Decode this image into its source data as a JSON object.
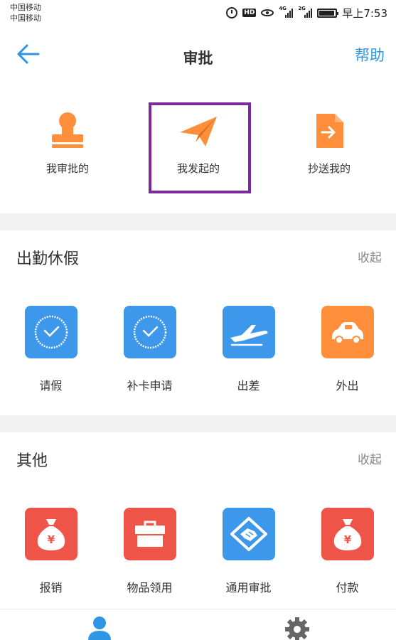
{
  "status_bar": {
    "carrier_1": "中国移动",
    "carrier_2": "中国移动",
    "hd_badge": "HD",
    "network_1": "4G",
    "network_2": "2G",
    "time": "早上7:53"
  },
  "header": {
    "title": "审批",
    "help_label": "帮助",
    "back_icon": "arrow-left-icon"
  },
  "top_tabs": [
    {
      "label": "我审批的",
      "icon": "stamp-icon",
      "color": "#ff8f3a"
    },
    {
      "label": "我发起的",
      "icon": "paper-plane-icon",
      "color": "#ff8f3a"
    },
    {
      "label": "抄送我的",
      "icon": "file-export-icon",
      "color": "#ff8f3a"
    }
  ],
  "highlight_color": "#7b2a9b",
  "sections": [
    {
      "title": "出勤休假",
      "collapse_label": "收起",
      "items": [
        {
          "label": "请假",
          "icon": "clock-icon",
          "color": "#3d97eb"
        },
        {
          "label": "补卡申请",
          "icon": "clock-icon",
          "color": "#3d97eb"
        },
        {
          "label": "出差",
          "icon": "airplane-icon",
          "color": "#3d97eb"
        },
        {
          "label": "外出",
          "icon": "car-icon",
          "color": "#ff8f3a"
        }
      ]
    },
    {
      "title": "其他",
      "collapse_label": "收起",
      "items": [
        {
          "label": "报销",
          "icon": "money-bag-icon",
          "color": "#ef5448"
        },
        {
          "label": "物品领用",
          "icon": "toolbox-icon",
          "color": "#ef5448"
        },
        {
          "label": "通用审批",
          "icon": "handshake-icon",
          "color": "#3d97eb"
        },
        {
          "label": "付款",
          "icon": "money-bag-icon",
          "color": "#ef5448"
        }
      ]
    }
  ],
  "bottom_tabs": [
    {
      "icon": "person-icon",
      "color": "#2e96e4"
    },
    {
      "icon": "gear-icon",
      "color": "#666666"
    }
  ],
  "accent_color": "#2e96e4"
}
